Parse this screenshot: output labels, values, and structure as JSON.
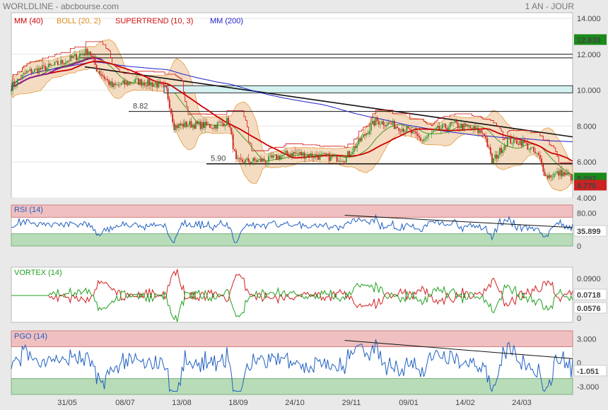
{
  "header": {
    "title": "WORLDLINE - abcbourse.com",
    "period": "1 AN - JOUR"
  },
  "colors": {
    "mm40": "#cc0000",
    "boll": "#e08a1e",
    "supertrend": "#d01010",
    "mm200": "#2020cc",
    "candle_up": "#2a9a2a",
    "candle_down": "#cc2222",
    "price_badge": "#1a8a1a",
    "last_badge": "#cc2222",
    "rsi_line": "#2060c0",
    "vortex_plus": "#22a022",
    "vortex_minus": "#d02020",
    "pgo_line": "#2060c0",
    "zone_top": "#f0c0c0",
    "zone_bottom": "#b8dcb8"
  },
  "chart_data": [
    {
      "type": "line",
      "panel": "price",
      "legend": [
        "MM (40)",
        "BOLL (20, 2)",
        "SUPERTREND (10, 3)",
        "MM (200)"
      ],
      "y_ticks": [
        "14.000",
        "12.000",
        "10.000",
        "8.000",
        "6.000",
        "4.000"
      ],
      "ylim": [
        4,
        14
      ],
      "x_ticks": [
        "31/05",
        "08/07",
        "13/08",
        "18/09",
        "24/10",
        "29/11",
        "09/01",
        "14/02",
        "24/03"
      ],
      "price_anchors": [
        [
          0,
          10.2
        ],
        [
          10,
          11.0
        ],
        [
          25,
          11.3
        ],
        [
          40,
          11.8
        ],
        [
          50,
          12.2
        ],
        [
          55,
          11.2
        ],
        [
          65,
          10.2
        ],
        [
          80,
          10.5
        ],
        [
          95,
          10.3
        ],
        [
          100,
          10.0
        ],
        [
          105,
          8.0
        ],
        [
          115,
          8.1
        ],
        [
          130,
          8.0
        ],
        [
          140,
          8.3
        ],
        [
          145,
          6.0
        ],
        [
          165,
          6.1
        ],
        [
          180,
          6.5
        ],
        [
          200,
          6.3
        ],
        [
          215,
          6.2
        ],
        [
          225,
          7.2
        ],
        [
          235,
          8.3
        ],
        [
          245,
          8.1
        ],
        [
          255,
          7.8
        ],
        [
          265,
          7.2
        ],
        [
          275,
          7.8
        ],
        [
          285,
          8.1
        ],
        [
          295,
          7.9
        ],
        [
          305,
          7.6
        ],
        [
          310,
          6.0
        ],
        [
          320,
          7.2
        ],
        [
          330,
          7.1
        ],
        [
          340,
          6.3
        ],
        [
          345,
          5.2
        ],
        [
          355,
          5.4
        ],
        [
          362,
          5.1
        ]
      ],
      "horizontal_levels": [
        {
          "value": 12.0,
          "label": ""
        },
        {
          "value": 11.8,
          "label": ""
        },
        {
          "value": 8.82,
          "label": "8.82"
        },
        {
          "value": 5.9,
          "label": "5.90"
        }
      ],
      "zone": [
        9.85,
        10.25
      ],
      "price_badges": [
        "12.830",
        "5.092",
        "4.770"
      ]
    },
    {
      "type": "line",
      "panel": "rsi",
      "title": "RSI (14)",
      "y_ticks": [
        "80.00",
        "0"
      ],
      "ylim": [
        0,
        100
      ],
      "levels": [
        70,
        30
      ],
      "last_value": "35.899"
    },
    {
      "type": "line",
      "panel": "vortex",
      "title": "VORTEX (14)",
      "y_ticks": [
        "0.0900",
        "0"
      ],
      "values_last": [
        "0.0718",
        "0.0576"
      ]
    },
    {
      "type": "line",
      "panel": "pgo",
      "title": "PGO (14)",
      "y_ticks": [
        "3.000",
        "0",
        "-3.000"
      ],
      "ylim": [
        -4,
        4
      ],
      "levels": [
        2,
        -2
      ],
      "last_value": "-1.051"
    }
  ]
}
